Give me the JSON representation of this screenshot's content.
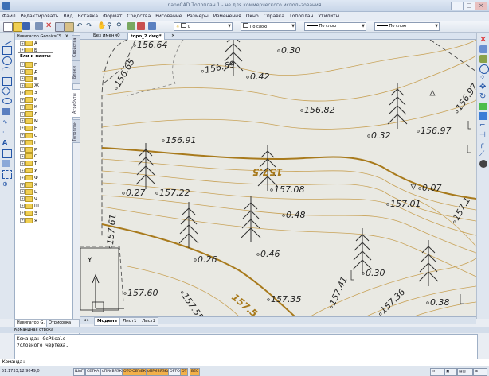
{
  "window": {
    "title": "nanoCAD Топоплан 1 - не для коммерческого использования"
  },
  "menu": [
    "Файл",
    "Редактировать",
    "Вид",
    "Вставка",
    "Формат",
    "Средства",
    "Рисование",
    "Размеры",
    "Изменения",
    "Окно",
    "Справка",
    "Топоплан",
    "Утилиты"
  ],
  "toolbar": {
    "layer_value": "0",
    "color_value": "По слою",
    "linetype_value": "По слою",
    "lineweight_value": "По слою"
  },
  "navigator": {
    "title": "Навигатор GeonicsCS",
    "close": "x",
    "items": [
      "А",
      "Б",
      "В",
      "Г",
      "Д",
      "Е",
      "Ж",
      "З",
      "И",
      "К",
      "Л",
      "М",
      "Н",
      "О",
      "П",
      "Р",
      "С",
      "Т",
      "У",
      "Ф",
      "Х",
      "Ц",
      "Ч",
      "Ш",
      "Э",
      "Я"
    ],
    "tooltip": "Ели и пихты",
    "side_tabs": [
      "Свойства",
      "Атрибуты",
      "Блоки",
      "Топоплан"
    ]
  },
  "document_tabs": [
    "Без имени0",
    "topo_2.dwg*"
  ],
  "drawing": {
    "elevations": [
      "156.64",
      "156.69",
      "156.65",
      "156.82",
      "156.97",
      "156.91",
      "157.22",
      "157.08",
      "157.01",
      "157.60",
      "157.35",
      "157.41",
      "157.36",
      "157.55",
      "157.61",
      "157.1",
      "156.97"
    ],
    "heights": [
      "0.30",
      "0.42",
      "0.32",
      "0.27",
      "0.07",
      "0.48",
      "0.26",
      "0.46",
      "0.30",
      "0.38"
    ],
    "contours": [
      "157.5",
      "157.5"
    ],
    "ucs_label": "Y"
  },
  "layout_tabs": [
    "Модель",
    "Лист1",
    "Лист2"
  ],
  "nav_bottom_tabs": [
    "Навигатор G...",
    "Отрисовка т..."
  ],
  "command": {
    "title": "Командная строка",
    "lines": [
      "Команда: GcPScale",
      "Условного чертежа."
    ],
    "prompt": "Команда:"
  },
  "status": {
    "coords": "51.1733,12.9049,0",
    "buttons": [
      {
        "label": "ШАГ",
        "on": false
      },
      {
        "label": "СЕТКА",
        "on": false
      },
      {
        "label": "оПРИВЯЗКА",
        "on": false
      },
      {
        "label": "ОТС-ОБЪЕКТ",
        "on": true
      },
      {
        "label": "оПРИВЯЗКА",
        "on": true
      },
      {
        "label": "ОРТО",
        "on": false
      },
      {
        "label": "ОТ",
        "on": true
      },
      {
        "label": "ВЕС",
        "on": true
      }
    ]
  },
  "colors": {
    "accent": "#f2b04a",
    "contour": "#c8a257",
    "contour_major": "#a87a1c"
  }
}
